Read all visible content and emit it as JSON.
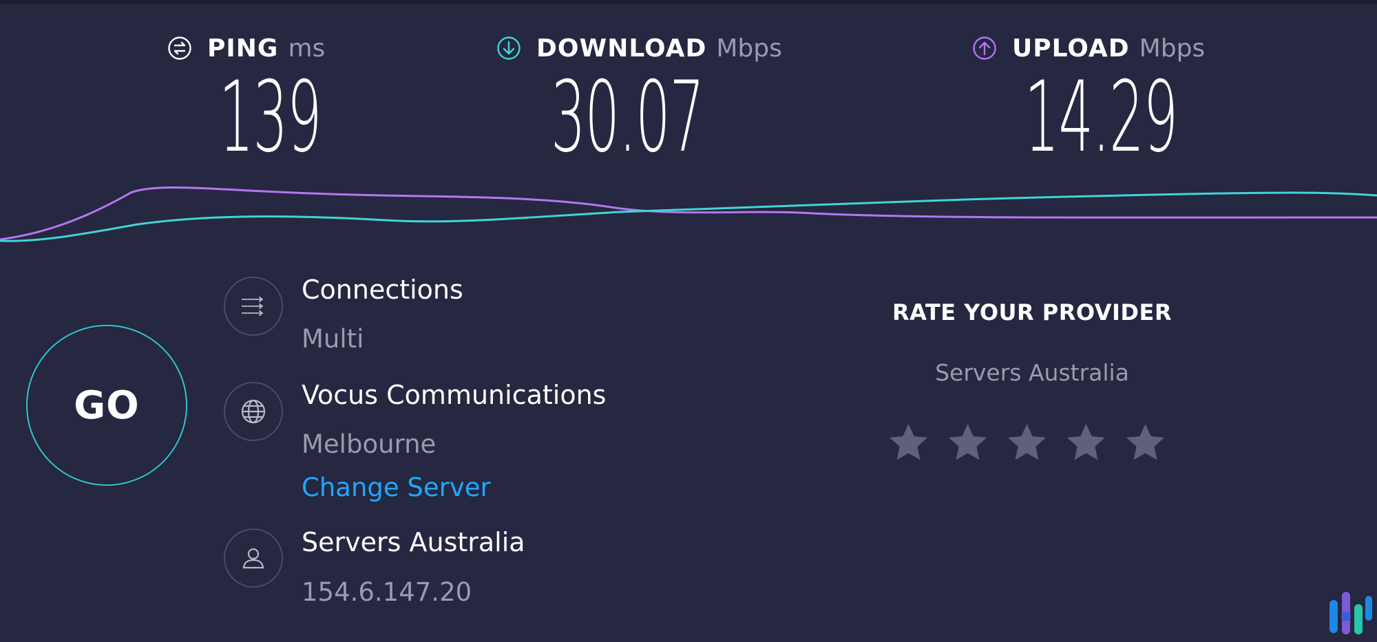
{
  "metrics": {
    "ping": {
      "label": "PING",
      "unit": "ms",
      "value": "139",
      "icon": "ping-icon"
    },
    "download": {
      "label": "DOWNLOAD",
      "unit": "Mbps",
      "value": "30.07",
      "icon": "download-arrow-icon"
    },
    "upload": {
      "label": "UPLOAD",
      "unit": "Mbps",
      "value": "14.29",
      "icon": "upload-arrow-icon"
    }
  },
  "go_button": {
    "label": "GO"
  },
  "connections": {
    "title": "Connections",
    "value": "Multi",
    "icon": "connections-arrows-icon"
  },
  "server": {
    "name": "Vocus Communications",
    "location": "Melbourne",
    "change_label": "Change Server",
    "icon": "globe-icon"
  },
  "host": {
    "name": "Servers Australia",
    "ip": "154.6.147.20",
    "icon": "user-icon"
  },
  "rating": {
    "title": "RATE YOUR PROVIDER",
    "provider": "Servers Australia",
    "max_stars": 5,
    "selected_stars": 0
  },
  "colors": {
    "background": "#262740",
    "go_ring": "#2ec6cf",
    "download_line": "#3fd6d6",
    "upload_line": "#b477f0",
    "link": "#1ea7ff",
    "star": "#5f607a"
  }
}
